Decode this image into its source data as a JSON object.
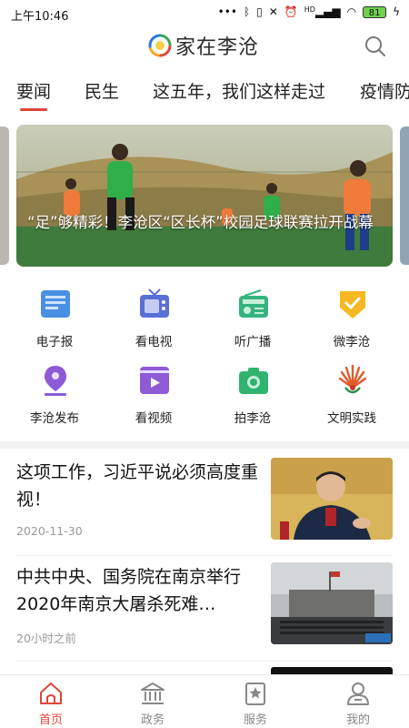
{
  "status_bar": {
    "time": "上午10:46",
    "battery": "81",
    "signal_label": "HD"
  },
  "header": {
    "app_title": "家在李沧"
  },
  "tabs": [
    {
      "label": "要闻"
    },
    {
      "label": "民生"
    },
    {
      "label": "这五年，我们这样走过"
    },
    {
      "label": "疫情防"
    }
  ],
  "banner": {
    "caption": "“足”够精彩！李沧区“区长杯”校园足球联赛拉开战幕"
  },
  "services": [
    {
      "label": "电子报",
      "icon": "newspaper-icon"
    },
    {
      "label": "看电视",
      "icon": "tv-icon"
    },
    {
      "label": "听广播",
      "icon": "radio-icon"
    },
    {
      "label": "微李沧",
      "icon": "badge-check-icon"
    },
    {
      "label": "李沧发布",
      "icon": "pen-nib-icon"
    },
    {
      "label": "看视频",
      "icon": "video-icon"
    },
    {
      "label": "拍李沧",
      "icon": "camera-icon"
    },
    {
      "label": "文明实践",
      "icon": "emblem-icon"
    }
  ],
  "news": [
    {
      "title": "这项工作，习近平说必须高度重视！",
      "meta": "2020-11-30"
    },
    {
      "title": "中共中央、国务院在南京举行2020年南京大屠杀死难…",
      "meta": "20小时之前"
    }
  ],
  "bottom_nav": [
    {
      "label": "首页",
      "icon": "home-icon",
      "active": true
    },
    {
      "label": "政务",
      "icon": "government-icon",
      "active": false
    },
    {
      "label": "服务",
      "icon": "service-star-icon",
      "active": false
    },
    {
      "label": "我的",
      "icon": "profile-icon",
      "active": false
    }
  ],
  "colors": {
    "accent": "#e0463a",
    "inactive_nav": "#888888"
  }
}
